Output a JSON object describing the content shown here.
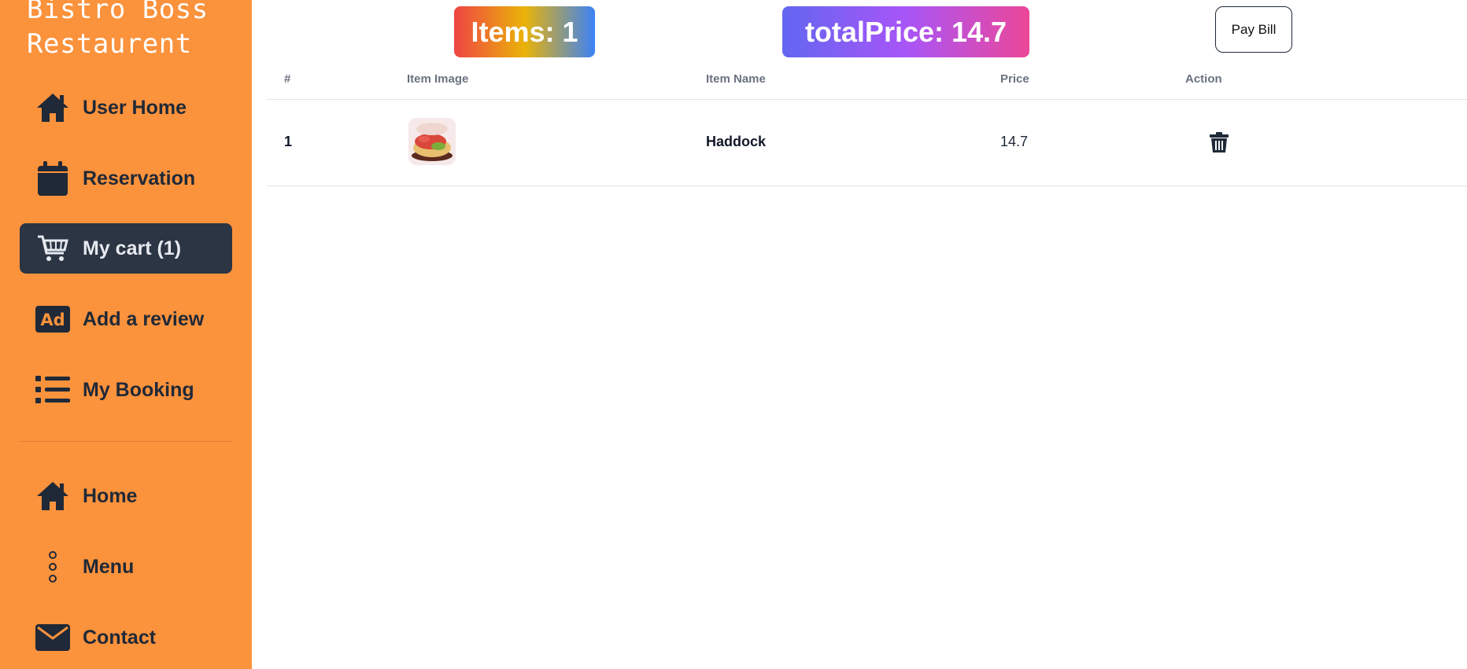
{
  "brand": {
    "line1": "Bistro Boss",
    "line2": "Restaurent"
  },
  "sidebar": {
    "items": [
      {
        "label": "User Home",
        "icon": "home-icon"
      },
      {
        "label": "Reservation",
        "icon": "calendar-icon"
      },
      {
        "label": "My cart (1)",
        "icon": "cart-icon",
        "active": true
      },
      {
        "label": "Add a review",
        "icon": "ad-icon"
      },
      {
        "label": "My Booking",
        "icon": "list-icon"
      }
    ],
    "bottom_items": [
      {
        "label": "Home",
        "icon": "home-icon"
      },
      {
        "label": "Menu",
        "icon": "vertical-dots-icon"
      },
      {
        "label": "Contact",
        "icon": "envelope-icon"
      }
    ]
  },
  "summary": {
    "items_label": "Items: 1",
    "total_label": "totalPrice: 14.7",
    "pay_button": "Pay Bill"
  },
  "table": {
    "headers": [
      "#",
      "Item Image",
      "Item Name",
      "Price",
      "Action"
    ],
    "rows": [
      {
        "index": "1",
        "name": "Haddock",
        "price": "14.7"
      }
    ]
  },
  "colors": {
    "sidebar_bg": "#fb923c",
    "active_bg": "#2b3544"
  }
}
